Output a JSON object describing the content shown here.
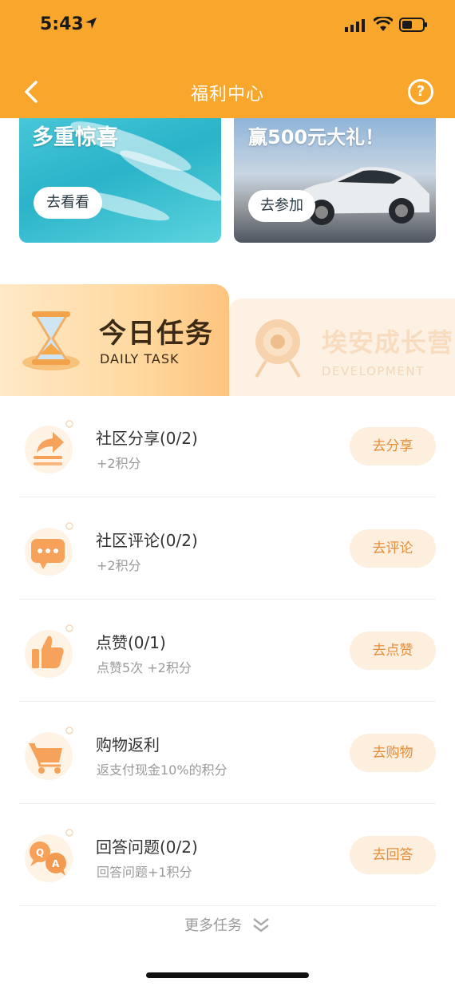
{
  "status": {
    "time": "5:43"
  },
  "nav": {
    "title": "福利中心",
    "help": "?"
  },
  "banners": [
    {
      "title": "多重惊喜",
      "button": "去看看"
    },
    {
      "title": "赢500元大礼！",
      "button": "去参加"
    }
  ],
  "tabs": [
    {
      "title": "今日任务",
      "subtitle": "DAILY TASK",
      "active": true
    },
    {
      "title": "埃安成长营",
      "subtitle": "DEVELOPMENT",
      "active": false
    }
  ],
  "tasks": [
    {
      "name": "社区分享(0/2)",
      "sub": "+2积分",
      "button": "去分享",
      "icon": "share-icon"
    },
    {
      "name": "社区评论(0/2)",
      "sub": "+2积分",
      "button": "去评论",
      "icon": "comment-icon"
    },
    {
      "name": "点赞(0/1)",
      "sub": "点赞5次 +2积分",
      "button": "去点赞",
      "icon": "thumbs-up-icon"
    },
    {
      "name": "购物返利",
      "sub": "返支付现金10%的积分",
      "button": "去购物",
      "icon": "cart-icon"
    },
    {
      "name": "回答问题(0/2)",
      "sub": "回答问题+1积分",
      "button": "去回答",
      "icon": "qa-icon"
    }
  ],
  "more": {
    "label": "更多任务"
  },
  "colors": {
    "header": "#f8a62c",
    "accent": "#e58e3a",
    "button_bg": "#fdeedd"
  }
}
